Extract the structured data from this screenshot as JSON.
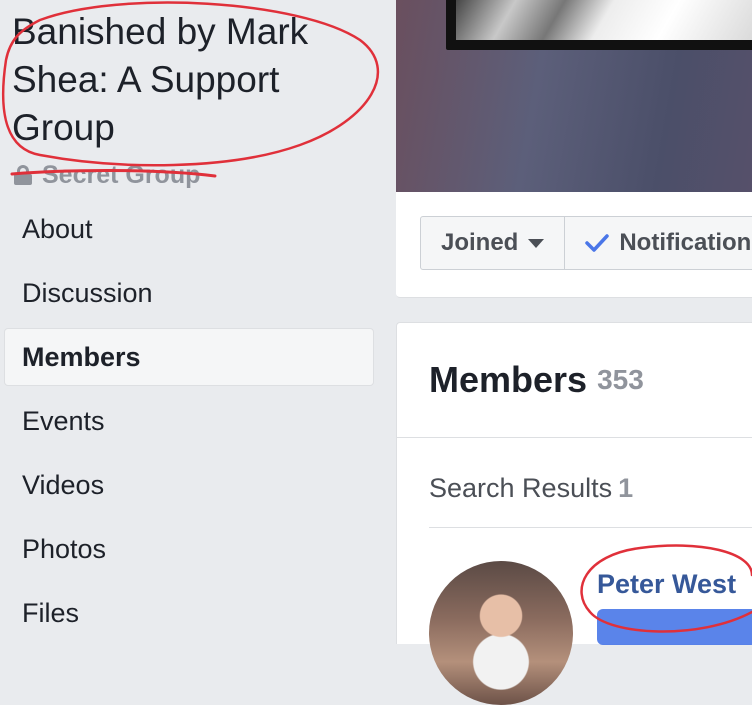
{
  "group": {
    "title": "Banished by Mark Shea: A Support Group",
    "privacy": "Secret Group"
  },
  "nav": {
    "items": [
      {
        "label": "About",
        "active": false
      },
      {
        "label": "Discussion",
        "active": false
      },
      {
        "label": "Members",
        "active": true
      },
      {
        "label": "Events",
        "active": false
      },
      {
        "label": "Videos",
        "active": false
      },
      {
        "label": "Photos",
        "active": false
      },
      {
        "label": "Files",
        "active": false
      }
    ]
  },
  "actions": {
    "joined_label": "Joined",
    "notifications_label": "Notifications"
  },
  "members": {
    "title": "Members",
    "count": "353",
    "search_results_label": "Search Results",
    "search_results_count": "1",
    "results": [
      {
        "name": "Peter West"
      }
    ]
  },
  "colors": {
    "annotation": "#e0303a",
    "link": "#365899",
    "redaction": "#3d6fe6"
  }
}
